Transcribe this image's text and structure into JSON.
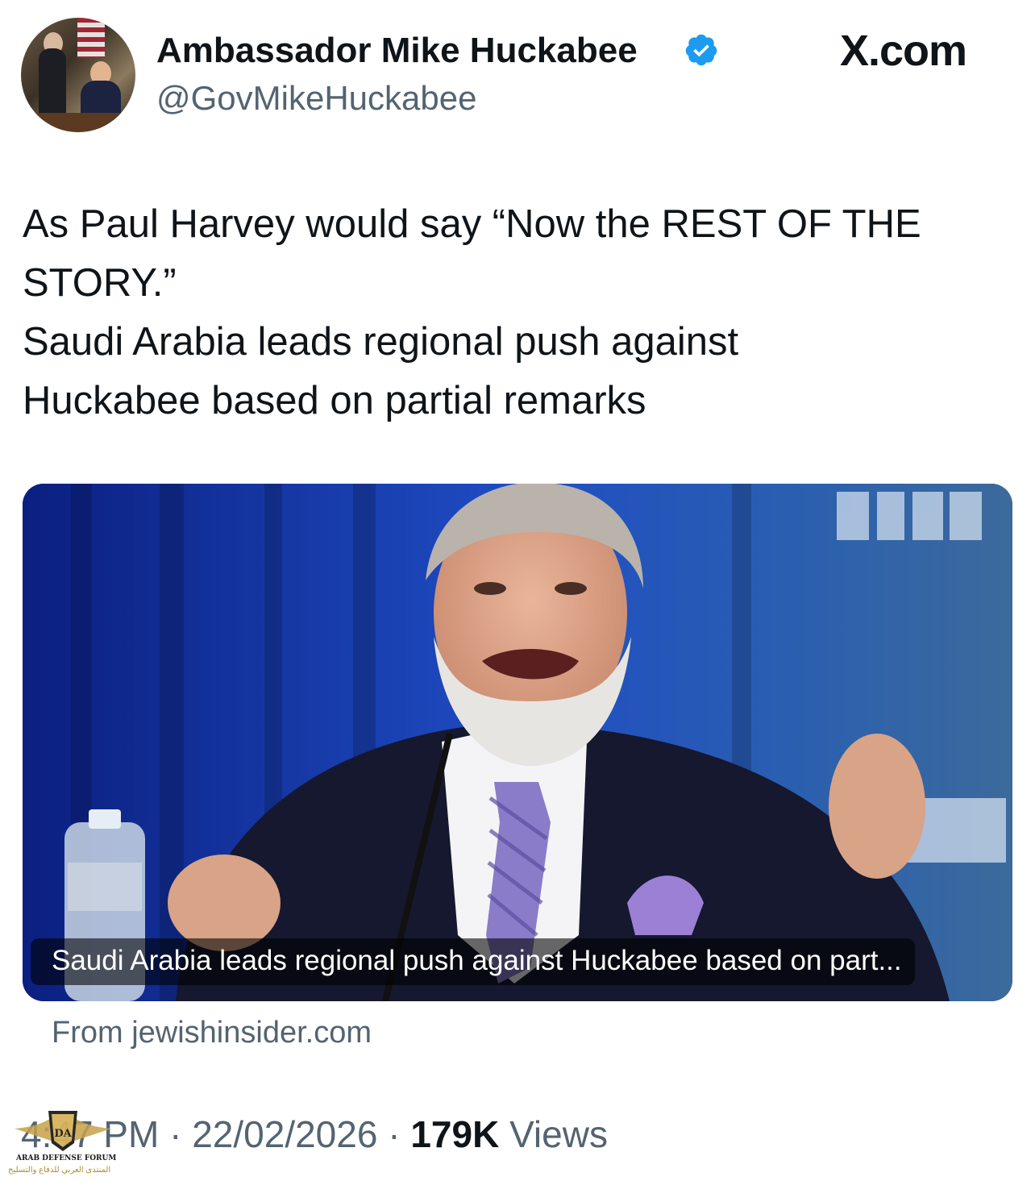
{
  "header": {
    "display_name": "Ambassador Mike Huckabee",
    "handle": "@GovMikeHuckabee",
    "brand": "X.com",
    "verified_icon": "verified-badge-icon"
  },
  "tweet": {
    "lines": [
      "As Paul Harvey would say “Now the REST OF THE",
      "STORY.”",
      "Saudi Arabia leads regional push against",
      "Huckabee based on partial remarks"
    ]
  },
  "card": {
    "caption": "Saudi Arabia leads regional push against Huckabee based on part...",
    "source": "From jewishinsider.com"
  },
  "meta": {
    "time": "4:47 PM",
    "separator": "·",
    "date": "22/02/2026",
    "views_count": "179K",
    "views_label": "Views"
  },
  "watermark": {
    "emblem": "DA",
    "name_en": "ARAB DEFENSE FORUM",
    "name_ar": "المنتدى العربي للدفاع والتسليح"
  },
  "colors": {
    "text_primary": "#0f1419",
    "text_secondary": "#536471",
    "verified_blue": "#1d9bf0",
    "card_background": "#1b3fb5"
  }
}
